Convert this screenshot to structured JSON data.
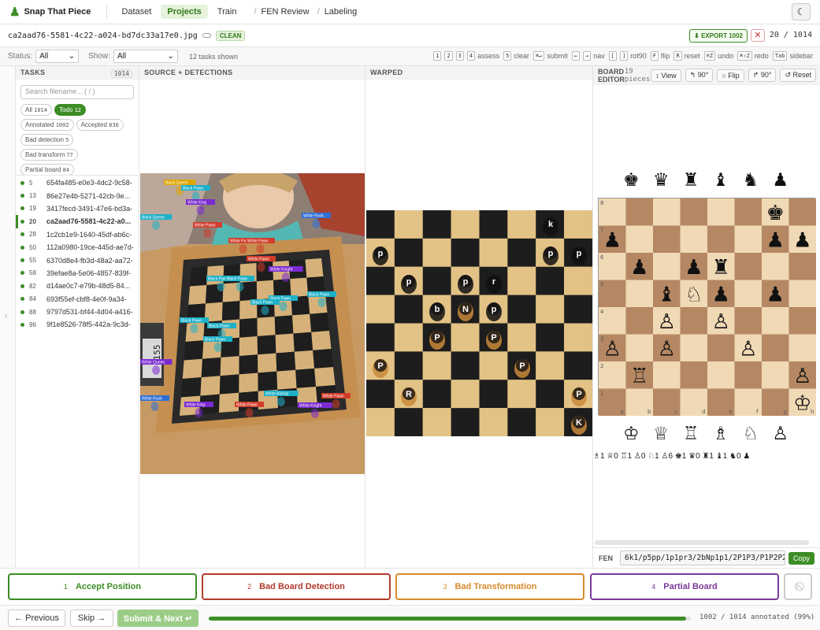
{
  "app": {
    "name": "Snap That Piece",
    "theme_icon": "moon-icon"
  },
  "nav": {
    "tabs": [
      "Dataset",
      "Projects",
      "Train"
    ],
    "active": "Projects",
    "crumbs": [
      "FEN Review",
      "Labeling"
    ]
  },
  "file": {
    "name": "ca2aad76-5581-4c22-a024-bd7dc33a17e0.jpg",
    "status": "CLEAN",
    "export_label": "⬇ EXPORT 1002",
    "counter": "20 / 1014"
  },
  "filters": {
    "status_label": "Status:",
    "status_value": "All",
    "show_label": "Show:",
    "show_value": "All",
    "count_text": "12 tasks shown"
  },
  "shortcuts": [
    {
      "keys": [
        "1",
        "2",
        "3",
        "4"
      ],
      "label": "assess"
    },
    {
      "keys": [
        "5"
      ],
      "label": "clear"
    },
    {
      "keys": [
        "⌘↵"
      ],
      "label": "submit"
    },
    {
      "keys": [
        "←",
        "→"
      ],
      "label": "nav"
    },
    {
      "keys": [
        "[",
        "]"
      ],
      "label": "rot90"
    },
    {
      "keys": [
        "F"
      ],
      "label": "flip"
    },
    {
      "keys": [
        "R"
      ],
      "label": "reset"
    },
    {
      "keys": [
        "⌘Z"
      ],
      "label": "undo"
    },
    {
      "keys": [
        "⌘⇧Z"
      ],
      "label": "redo"
    },
    {
      "keys": [
        "Tab"
      ],
      "label": "sidebar"
    }
  ],
  "tasks": {
    "header": "TASKS",
    "total": "1014",
    "search_placeholder": "Search filename... ( / )",
    "chips": [
      {
        "label": "All",
        "count": "1014",
        "active": false
      },
      {
        "label": "Todo",
        "count": "12",
        "active": true
      },
      {
        "label": "Annotated",
        "count": "1002",
        "active": false
      },
      {
        "label": "Accepted",
        "count": "836",
        "active": false
      },
      {
        "label": "Bad detection",
        "count": "5",
        "active": false
      },
      {
        "label": "Bad transform",
        "count": "77",
        "active": false
      },
      {
        "label": "Partial board",
        "count": "84",
        "active": false
      }
    ],
    "rows": [
      {
        "num": "5",
        "name": "654fa485-e0e3-4dc2-9c58-"
      },
      {
        "num": "13",
        "name": "86e27e4b-5271-42cb-9e..."
      },
      {
        "num": "19",
        "name": "3417fecd-3491-47e6-bd3a-"
      },
      {
        "num": "20",
        "name": "ca2aad76-5581-4c22-a0...",
        "selected": true
      },
      {
        "num": "28",
        "name": "1c2cb1e9-1640-45df-ab6c-"
      },
      {
        "num": "50",
        "name": "112a0980-19ce-445d-ae7d-"
      },
      {
        "num": "55",
        "name": "6370d8e4-fb3d-48a2-aa72-"
      },
      {
        "num": "58",
        "name": "39efae8a-5e06-4857-839f-"
      },
      {
        "num": "82",
        "name": "d14ae0c7-e79b-48d5-84..."
      },
      {
        "num": "84",
        "name": "693f55ef-cbf8-4e0f-9a34-"
      },
      {
        "num": "88",
        "name": "9797d531-bf44-4d04-a416-"
      },
      {
        "num": "96",
        "name": "9f1e8526-78f5-442a-9c3d-"
      }
    ]
  },
  "panels": {
    "source": "SOURCE + DETECTIONS",
    "warped": "WARPED"
  },
  "detections": [
    {
      "label": "Black Queen",
      "color": "#e0a500"
    },
    {
      "label": "Black Pawn",
      "color": "#1fb0c8"
    },
    {
      "label": "White King",
      "color": "#7a2ad0"
    },
    {
      "label": "Black Queen",
      "color": "#1fb0c8"
    },
    {
      "label": "White Pawn",
      "color": "#d23c2a"
    },
    {
      "label": "White Rook",
      "color": "#2f6fd6"
    },
    {
      "label": "White Pawn",
      "color": "#d23c2a"
    },
    {
      "label": "White Pawn",
      "color": "#d23c2a"
    },
    {
      "label": "White Pawn",
      "color": "#d23c2a"
    },
    {
      "label": "White Knight",
      "color": "#7a2ad0"
    },
    {
      "label": "Black Pawn",
      "color": "#1fb0c8"
    },
    {
      "label": "Black Pawn",
      "color": "#1fb0c8"
    },
    {
      "label": "Black Pawn",
      "color": "#1fb0c8"
    },
    {
      "label": "Black Pawn",
      "color": "#1fb0c8"
    },
    {
      "label": "Black Pawn",
      "color": "#1fb0c8"
    },
    {
      "label": "Black Pawn",
      "color": "#1fb0c8"
    },
    {
      "label": "Black Pawn",
      "color": "#1fb0c8"
    },
    {
      "label": "Black Pawn",
      "color": "#1fb0c8"
    },
    {
      "label": "White Queen",
      "color": "#7a2ad0"
    },
    {
      "label": "White Rook",
      "color": "#2f6fd6"
    },
    {
      "label": "White King",
      "color": "#7a2ad0"
    },
    {
      "label": "White Pawn",
      "color": "#d23c2a"
    },
    {
      "label": "White Bishop",
      "color": "#1fb0c8"
    },
    {
      "label": "White Knight",
      "color": "#7a2ad0"
    },
    {
      "label": "White Pawn",
      "color": "#d23c2a"
    }
  ],
  "warped_pieces": [
    "k",
    "p",
    "p",
    "p",
    "p",
    "p",
    "r",
    "b",
    "N",
    "p",
    "P",
    "P",
    "P",
    "P",
    "R",
    "P",
    "K"
  ],
  "editor": {
    "title": "BOARD EDITOR",
    "piece_count": "19 pieces",
    "buttons": [
      "↕ View",
      "↰ 90°",
      "○ Flip",
      "↱ 90°",
      "↺ Reset"
    ],
    "black_tray": [
      "♚",
      "♛",
      "♜",
      "♝",
      "♞",
      "♟"
    ],
    "white_tray": [
      "♔",
      "♕",
      "♖",
      "♗",
      "♘",
      "♙"
    ],
    "ranks": [
      "8",
      "7",
      "6",
      "5",
      "4",
      "3",
      "2",
      "1"
    ],
    "files": [
      "a",
      "b",
      "c",
      "d",
      "e",
      "f",
      "g",
      "h"
    ],
    "board": [
      [
        "",
        "",
        "",
        "",
        "",
        "",
        "♚",
        ""
      ],
      [
        "♟",
        "",
        "",
        "",
        "",
        "",
        "♟",
        "♟"
      ],
      [
        "",
        "♟",
        "",
        "♟",
        "♜",
        "",
        "",
        ""
      ],
      [
        "",
        "",
        "♝",
        "♘",
        "♟",
        "",
        "♟",
        ""
      ],
      [
        "",
        "",
        "♙",
        "",
        "♙",
        "",
        "",
        ""
      ],
      [
        "♙",
        "",
        "♙",
        "",
        "",
        "♙",
        "",
        ""
      ],
      [
        "",
        "♖",
        "",
        "",
        "",
        "",
        "",
        "♙"
      ],
      [
        "",
        "",
        "",
        "",
        "",
        "",
        "",
        "♔"
      ]
    ],
    "counts_text": "♗1 ♕0 ♖1 ♙0 ♘1 ♙6   ♚1 ♛0 ♜1 ♝1 ♞0 ♟",
    "fen_label": "FEN",
    "fen": "6k1/p5pp/1p1pr3/2bNp1p1/2P1P3/P1P2P2/1R5P/7K",
    "copy_label": "Copy"
  },
  "actions": [
    {
      "key": "1",
      "label": "Accept Position",
      "color": "#3c8d26"
    },
    {
      "key": "2",
      "label": "Bad Board Detection",
      "color": "#b23a2a"
    },
    {
      "key": "3",
      "label": "Bad Transformation",
      "color": "#d88a2a"
    },
    {
      "key": "4",
      "label": "Partial Board",
      "color": "#7a3a9a"
    },
    {
      "key": "5",
      "label": "⃠",
      "color": "#cccccc"
    }
  ],
  "footer": {
    "prev": "← Previous",
    "skip": "Skip →",
    "submit": "Submit & Next ↵",
    "progress": 0.99,
    "progress_text": "1002 / 1014 annotated (99%)"
  }
}
